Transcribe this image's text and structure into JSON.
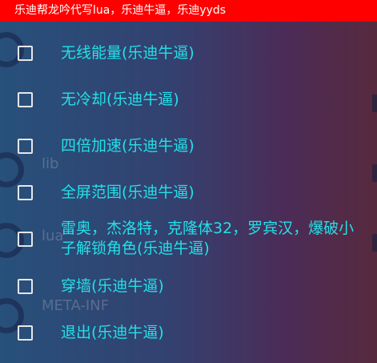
{
  "banner": {
    "text": "乐迪帮龙吟代写lua，乐迪牛逼，乐迪yyds"
  },
  "menu": {
    "items": [
      {
        "label": "无线能量(乐迪牛逼)"
      },
      {
        "label": "无冷却(乐迪牛逼)"
      },
      {
        "label": "四倍加速(乐迪牛逼)"
      },
      {
        "label": "全屏范围(乐迪牛逼)"
      },
      {
        "label": "雷奥，杰洛特，克隆体32，罗宾汉，爆破小子解锁角色(乐迪牛逼)"
      },
      {
        "label": "穿墙(乐迪牛逼)"
      },
      {
        "label": "退出(乐迪牛逼)"
      }
    ]
  },
  "background": {
    "files": [
      {
        "name": "lib"
      },
      {
        "name": "lua"
      },
      {
        "name": "META-INF"
      }
    ]
  },
  "colors": {
    "banner_bg": "#ff0000",
    "label_text": "#23e0e8",
    "checkbox_border": "#e6e6ea"
  }
}
